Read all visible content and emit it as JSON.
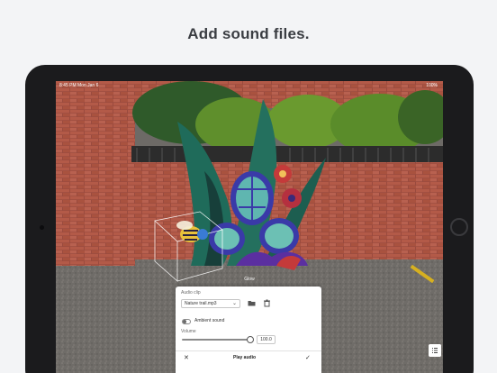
{
  "headline": "Add sound files.",
  "status_bar": {
    "time": "8:45 PM",
    "date": "Mon Jan 6",
    "battery": "100%"
  },
  "object_title": "Glow",
  "audio_panel": {
    "clip_label": "Audio clip",
    "clip_value": "Nature trail.mp3",
    "ambient_label": "Ambient sound",
    "ambient_on": false,
    "volume_label": "Volume",
    "volume_value": "100.0",
    "volume_level": 1.0,
    "play_label": "Play audio"
  },
  "icons": {
    "folder": "folder-icon",
    "delete": "trash-icon",
    "close": "close-icon",
    "confirm": "checkmark-icon",
    "list": "list-icon",
    "dropdown": "chevron-down-icon"
  },
  "colors": {
    "panel_bg": "#ffffff",
    "page_bg": "#f3f4f6",
    "device": "#1b1b1d"
  }
}
